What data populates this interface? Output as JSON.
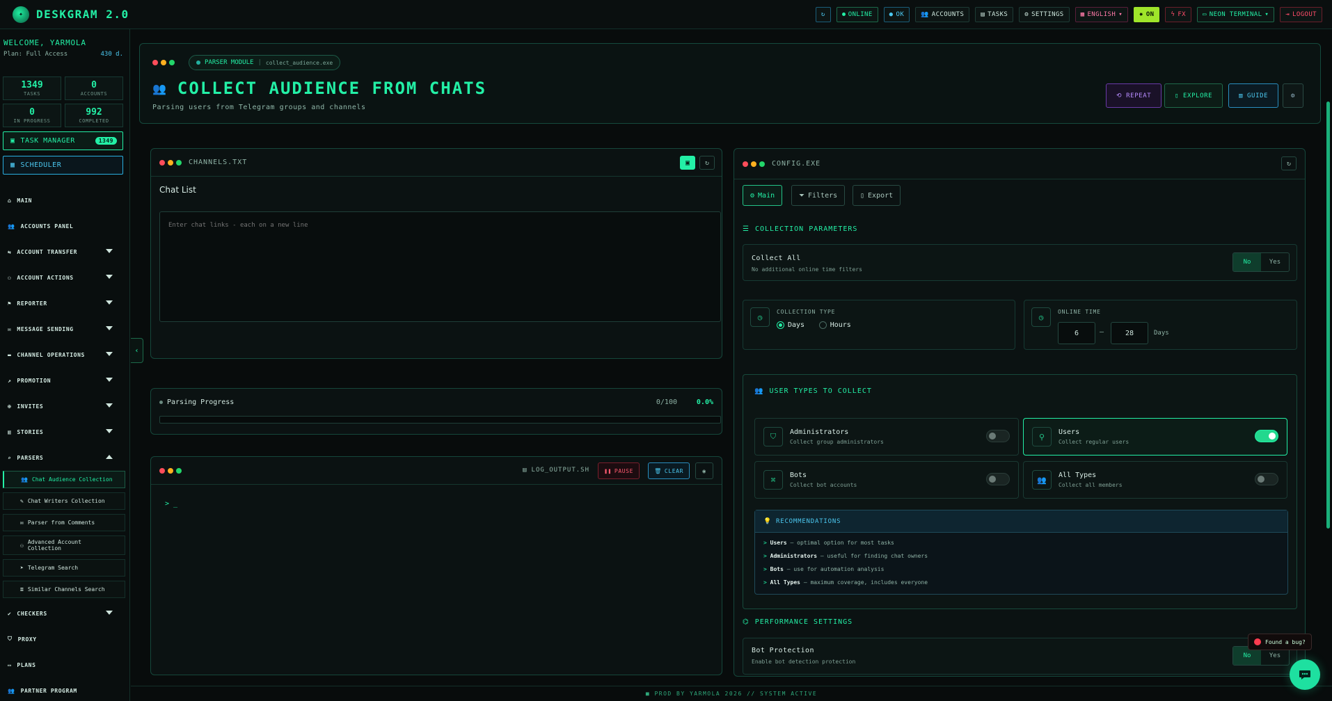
{
  "app": {
    "title": "DESKGRAM 2.0",
    "logo_icon": "sparkle-logo-icon"
  },
  "topbar": {
    "refresh_icon": "refresh-icon",
    "online": "ONLINE",
    "ok": "OK",
    "accounts": "ACCOUNTS",
    "tasks": "TASKS",
    "settings": "SETTINGS",
    "language": "ENGLISH",
    "on": "ON",
    "fx": "FX",
    "theme": "NEON TERMINAL",
    "logout": "LOGOUT"
  },
  "sidebar": {
    "welcome": "WELCOME, YARMOLA",
    "plan": "Plan: Full Access",
    "days": "430 d.",
    "stats": [
      {
        "value": "1349",
        "label": "TASKS"
      },
      {
        "value": "0",
        "label": "ACCOUNTS"
      },
      {
        "value": "0",
        "label": "IN PROGRESS"
      },
      {
        "value": "992",
        "label": "COMPLETED"
      }
    ],
    "task_manager": "TASK MANAGER",
    "task_manager_count": "1349",
    "scheduler": "SCHEDULER",
    "nav": [
      {
        "label": "MAIN",
        "expandable": false
      },
      {
        "label": "ACCOUNTS PANEL",
        "expandable": false
      },
      {
        "label": "ACCOUNT TRANSFER",
        "expandable": true
      },
      {
        "label": "ACCOUNT ACTIONS",
        "expandable": true
      },
      {
        "label": "REPORTER",
        "expandable": true
      },
      {
        "label": "MESSAGE SENDING",
        "expandable": true
      },
      {
        "label": "CHANNEL OPERATIONS",
        "expandable": true
      },
      {
        "label": "PROMOTION",
        "expandable": true
      },
      {
        "label": "INVITES",
        "expandable": true
      },
      {
        "label": "STORIES",
        "expandable": true
      },
      {
        "label": "PARSERS",
        "expandable": true
      }
    ],
    "parsers_sub": [
      "Chat Audience Collection",
      "Chat Writers Collection",
      "Parser from Comments",
      "Advanced Account Collection",
      "Telegram Search",
      "Similar Channels Search"
    ],
    "nav_bottom": [
      {
        "label": "CHECKERS",
        "expandable": true
      },
      {
        "label": "PROXY",
        "expandable": false
      },
      {
        "label": "PLANS",
        "expandable": false
      },
      {
        "label": "PARTNER PROGRAM",
        "expandable": false
      }
    ]
  },
  "header": {
    "module_tag": "PARSER MODULE",
    "module_file": "collect_audience.exe",
    "title": "COLLECT AUDIENCE FROM CHATS",
    "subtitle": "Parsing users from Telegram groups and channels",
    "repeat": "REPEAT",
    "explore": "EXPLORE",
    "guide": "GUIDE"
  },
  "channels_panel": {
    "file": "CHANNELS.TXT",
    "label": "Chat List",
    "placeholder": "Enter chat links - each on a new line"
  },
  "progress": {
    "label": "Parsing Progress",
    "count": "0/100",
    "percent_text": "0.0%",
    "fraction": 0.0
  },
  "log_panel": {
    "file": "LOG_OUTPUT.SH",
    "pause": "PAUSE",
    "clear": "CLEAR",
    "prompt": "> _"
  },
  "config": {
    "file": "CONFIG.EXE",
    "tabs": [
      "Main",
      "Filters",
      "Export"
    ],
    "collection_params_title": "COLLECTION PARAMETERS",
    "collect_all": {
      "label": "Collect All",
      "sub": "No additional online time filters",
      "no": "No",
      "yes": "Yes"
    },
    "collection_type": {
      "label": "COLLECTION TYPE",
      "days": "Days",
      "hours": "Hours"
    },
    "online_time": {
      "label": "ONLINE TIME",
      "from": "6",
      "dash": "—",
      "to": "28",
      "unit": "Days"
    },
    "user_types_title": "USER TYPES TO COLLECT",
    "user_types": [
      {
        "title": "Administrators",
        "sub": "Collect group administrators",
        "on": false
      },
      {
        "title": "Users",
        "sub": "Collect regular users",
        "on": true
      },
      {
        "title": "Bots",
        "sub": "Collect bot accounts",
        "on": false
      },
      {
        "title": "All Types",
        "sub": "Collect all members",
        "on": false
      }
    ],
    "reco_title": "RECOMMENDATIONS",
    "reco": [
      {
        "name": "Users",
        "text": " – optimal option for most tasks"
      },
      {
        "name": "Administrators",
        "text": " – useful for finding chat owners"
      },
      {
        "name": "Bots",
        "text": " – use for automation analysis"
      },
      {
        "name": "All Types",
        "text": " – maximum coverage, includes everyone"
      }
    ],
    "perf_title": "PERFORMANCE SETTINGS",
    "bot_protection": {
      "label": "Bot Protection",
      "sub": "Enable bot detection protection",
      "no": "No",
      "yes": "Yes"
    }
  },
  "footer": "■ PROD BY YARMOLA 2026   // SYSTEM ACTIVE",
  "bug_report": "Found a bug?",
  "colors": {
    "accent": "#23f0a6",
    "cyan": "#4cc8f0",
    "danger": "#ff4d6a",
    "violet": "#b78cff"
  }
}
